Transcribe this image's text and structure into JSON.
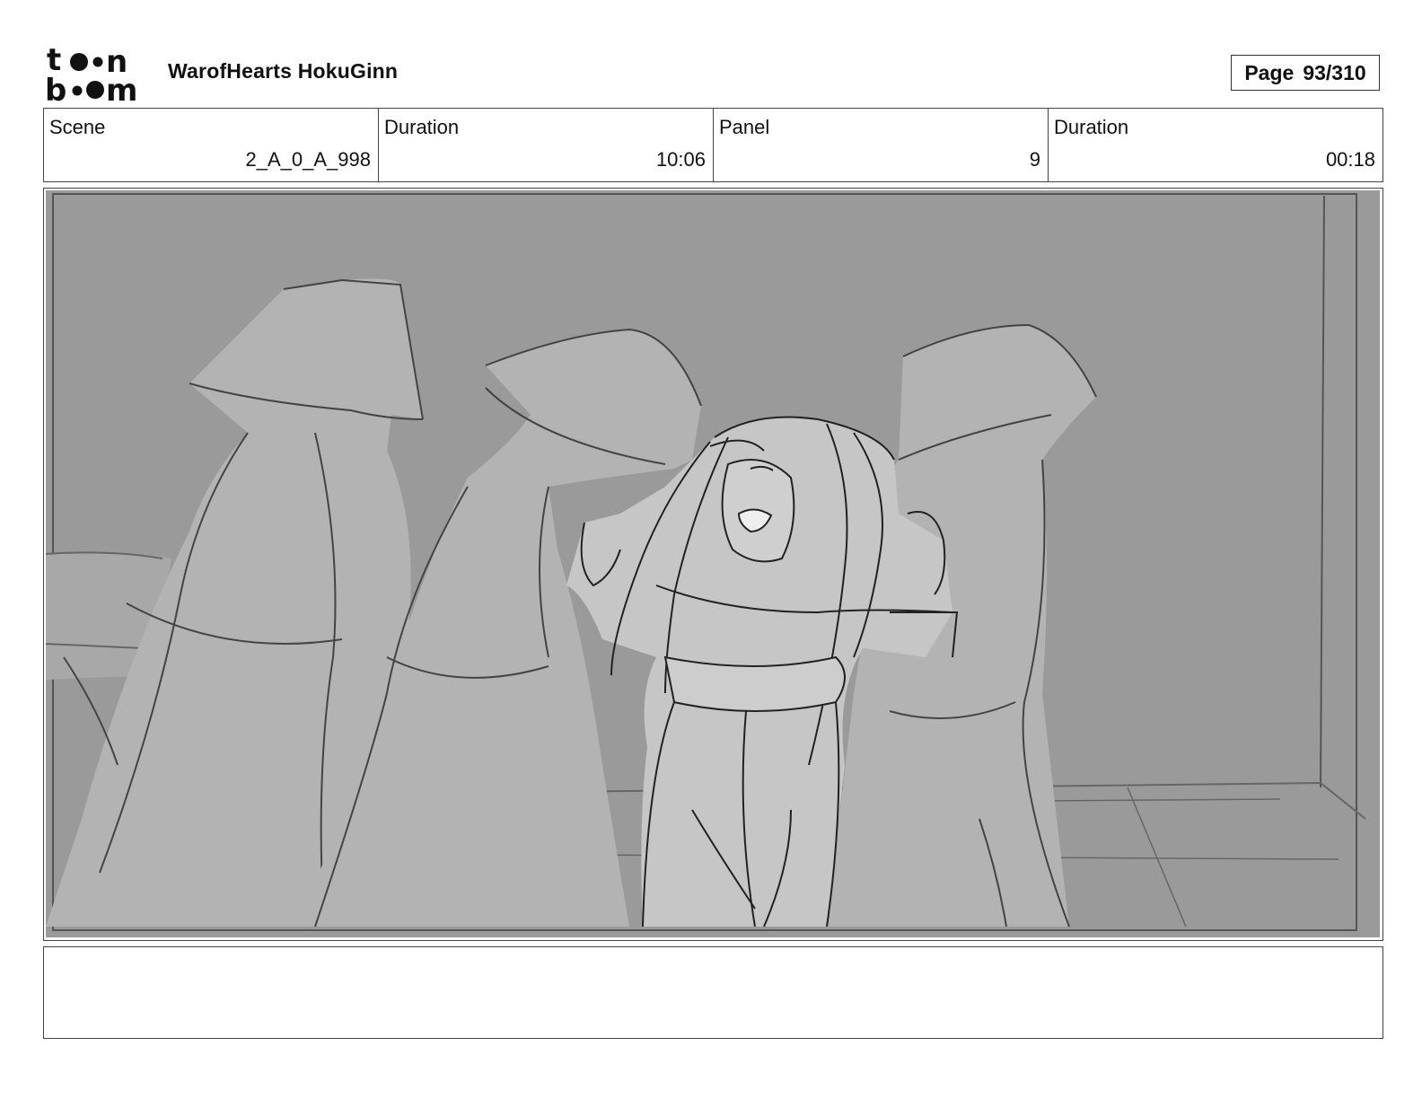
{
  "header": {
    "logo_text": "toon boom",
    "project_title": "WarofHearts HokuGinn",
    "page_label": "Page",
    "page_number": "93/310"
  },
  "info": {
    "scene_label": "Scene",
    "scene_value": "2_A_0_A_998",
    "scene_duration_label": "Duration",
    "scene_duration_value": "10:06",
    "panel_label": "Panel",
    "panel_value": "9",
    "panel_duration_label": "Duration",
    "panel_duration_value": "00:18"
  },
  "drawing": {
    "icon": "storyboard-sketch",
    "description_hidden": true
  },
  "notes": {
    "text": ""
  },
  "colors": {
    "background_gray": "#999999",
    "figure_gray": "#b3b3b3",
    "lead_figure_gray": "#c4c4c4",
    "line": "#222222"
  }
}
